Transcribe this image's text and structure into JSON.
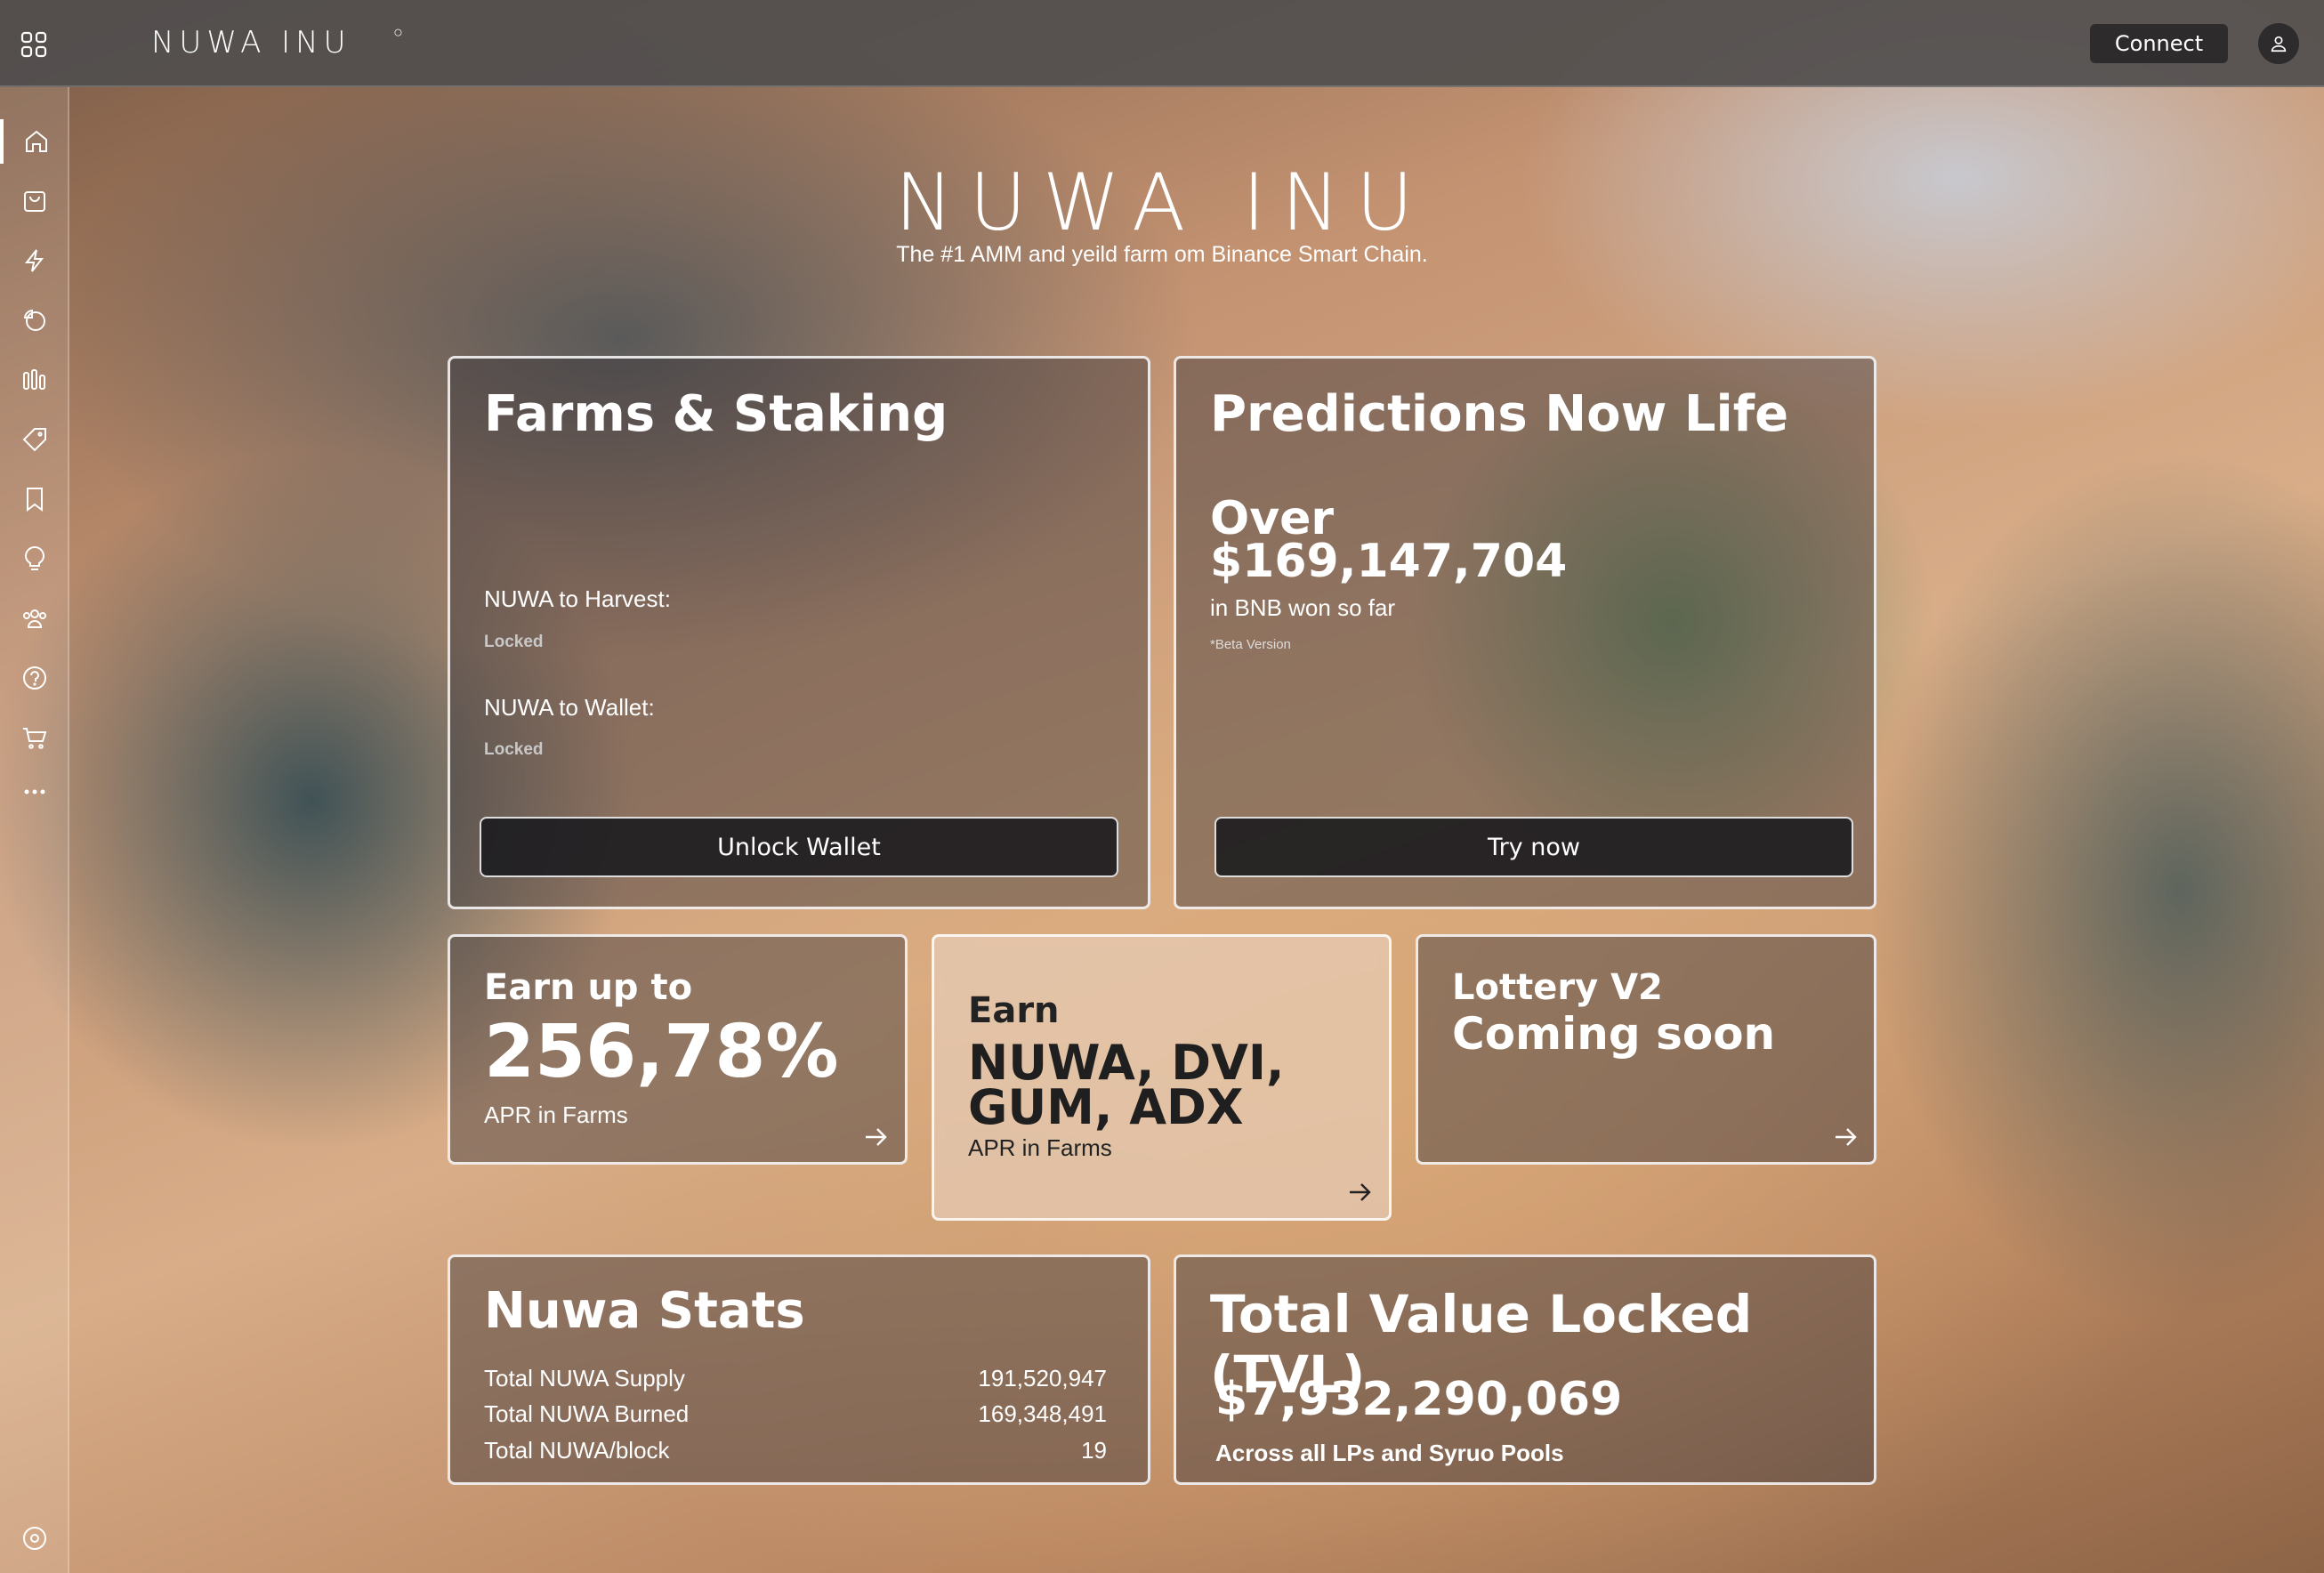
{
  "header": {
    "logo_text": "NUWA INU",
    "connect_label": "Connect"
  },
  "sidebar": {
    "items": [
      {
        "icon": "home-icon"
      },
      {
        "icon": "shopping-bag-icon"
      },
      {
        "icon": "lightning-icon"
      },
      {
        "icon": "pie-chart-icon"
      },
      {
        "icon": "bar-chart-icon"
      },
      {
        "icon": "tag-icon"
      },
      {
        "icon": "bookmark-icon"
      },
      {
        "icon": "lightbulb-icon"
      },
      {
        "icon": "users-icon"
      },
      {
        "icon": "help-icon"
      },
      {
        "icon": "cart-icon"
      },
      {
        "icon": "more-icon"
      },
      {
        "icon": "settings-icon"
      }
    ]
  },
  "hero": {
    "title": "NUWA INU",
    "subtitle": "The #1 AMM and yeild farm om Binance Smart Chain."
  },
  "farms": {
    "title": "Farms & Staking",
    "harvest_label": "NUWA to Harvest:",
    "harvest_value": "Locked",
    "wallet_label": "NUWA to Wallet:",
    "wallet_value": "Locked",
    "button": "Unlock Wallet"
  },
  "predictions": {
    "title": "Predictions Now Life",
    "over": "Over",
    "amount": "$169,147,704",
    "caption": "in BNB won so far",
    "note": "*Beta Version",
    "button": "Try now"
  },
  "earn_apr": {
    "pre": "Earn up to",
    "value": "256,78%",
    "caption": "APR in Farms"
  },
  "earn_tokens": {
    "pre": "Earn",
    "line1": "NUWA, DVI,",
    "line2": "GUM, ADX",
    "caption": "APR in Farms"
  },
  "lottery": {
    "line1": "Lottery V2",
    "line2": "Coming soon"
  },
  "stats": {
    "title": "Nuwa Stats",
    "rows": [
      {
        "label": "Total NUWA Supply",
        "value": "191,520,947"
      },
      {
        "label": "Total NUWA Burned",
        "value": "169,348,491"
      },
      {
        "label": "Total NUWA/block",
        "value": "19"
      }
    ]
  },
  "tvl": {
    "title": "Total Value Locked (TVL)",
    "amount": "$7,932,290,069",
    "caption": "Across all LPs and Syruo Pools"
  }
}
